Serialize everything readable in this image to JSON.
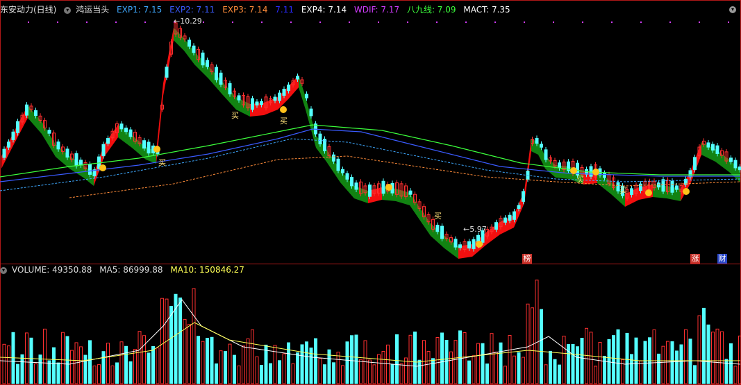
{
  "header": {
    "stock_title": "东安动力(日线)",
    "formula_name": "鸿运当头",
    "indicators": [
      {
        "label": "EXP1: 7.15",
        "color": "#3fa9ff"
      },
      {
        "label": "EXP2: 7.11",
        "color": "#3a5bff"
      },
      {
        "label": "EXP3: 7.14",
        "color": "#ff8c3a"
      },
      {
        "label": "7.11",
        "color": "#2b2bff"
      },
      {
        "label": "EXP4: 7.14",
        "color": "#ffffff"
      },
      {
        "label": "WDIF: 7.17",
        "color": "#d23cff"
      },
      {
        "label": "八九线: 7.09",
        "color": "#3cff3c"
      },
      {
        "label": "MACT: 7.35",
        "color": "#ffffff"
      }
    ]
  },
  "price_panel": {
    "high_label": "10.29",
    "low_label": "5.97",
    "buy_label": "买",
    "event_tags": [
      {
        "text": "榜",
        "color": "#c8322a"
      },
      {
        "text": "涨",
        "color": "#c8322a"
      },
      {
        "text": "财",
        "color": "#2a48c8"
      }
    ]
  },
  "volume_panel": {
    "icon": "chevron-down-icon",
    "labels": [
      {
        "label": "VOLUME: 49350.88",
        "color": "#dddddd"
      },
      {
        "label": "MA5: 86999.88",
        "color": "#dddddd"
      },
      {
        "label": "MA10: 150846.27",
        "color": "#ffff55"
      }
    ]
  },
  "colors": {
    "up": "#ff3030",
    "down": "#54ffff",
    "ribbon_up": "#ff1010",
    "ribbon_down": "#138a13",
    "divider": "#b01818"
  }
}
